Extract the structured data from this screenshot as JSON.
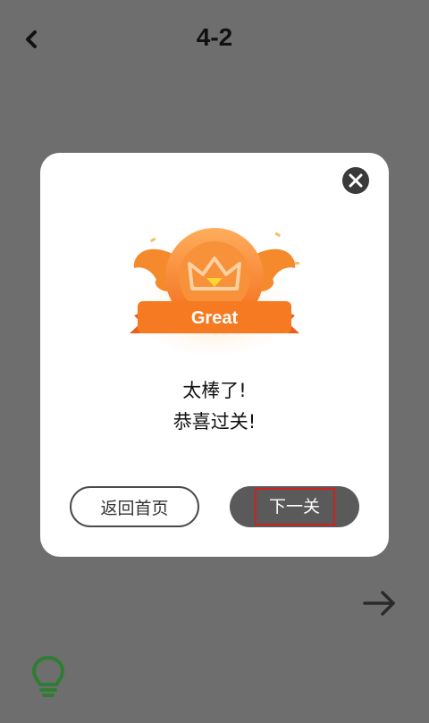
{
  "header": {
    "title": "4-2",
    "back_icon": "chevron-left-icon"
  },
  "modal": {
    "close_icon": "close-icon",
    "badge_label": "Great",
    "message_line1": "太棒了!",
    "message_line2": "恭喜过关!",
    "home_button_label": "返回首页",
    "next_button_label": "下一关"
  },
  "footer": {
    "next_icon": "arrow-right-icon",
    "hint_icon": "lightbulb-icon"
  },
  "colors": {
    "overlay": "#6e6e6e",
    "badge_orange": "#f5862a",
    "hint_green": "#2e7d32",
    "highlight_red": "#d02020"
  }
}
